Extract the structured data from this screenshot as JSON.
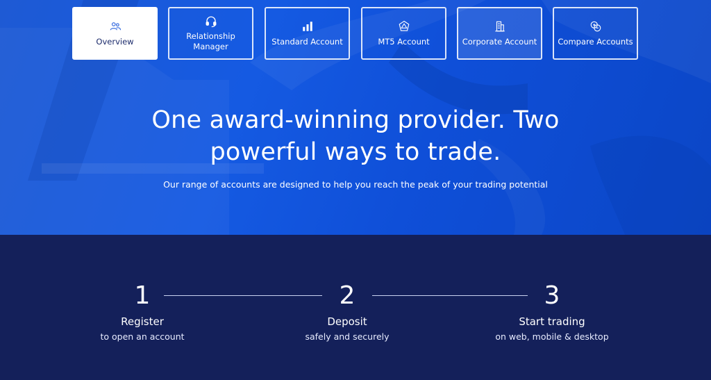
{
  "tabs": [
    {
      "label": "Overview",
      "icon": "people-icon",
      "active": true
    },
    {
      "label": "Relationship Manager",
      "icon": "headset-icon"
    },
    {
      "label": "Standard Account",
      "icon": "bar-chart-icon"
    },
    {
      "label": "MT5 Account",
      "icon": "mt5-logo-icon"
    },
    {
      "label": "Corporate Account",
      "icon": "building-icon"
    },
    {
      "label": "Compare Accounts",
      "icon": "compare-icon"
    }
  ],
  "hero": {
    "headline_line1": "One award-winning provider. Two",
    "headline_line2": "powerful ways to trade.",
    "subline": "Our range of accounts are designed to help you reach the peak of your trading potential"
  },
  "steps": [
    {
      "number": "1",
      "title": "Register",
      "desc": "to open an account"
    },
    {
      "number": "2",
      "title": "Deposit",
      "desc": "safely and securely"
    },
    {
      "number": "3",
      "title": "Start trading",
      "desc": "on web, mobile & desktop"
    }
  ],
  "colors": {
    "hero_blue": "#155ae2",
    "dark_navy": "#14205a",
    "active_tab_text": "#1b2a6b"
  }
}
